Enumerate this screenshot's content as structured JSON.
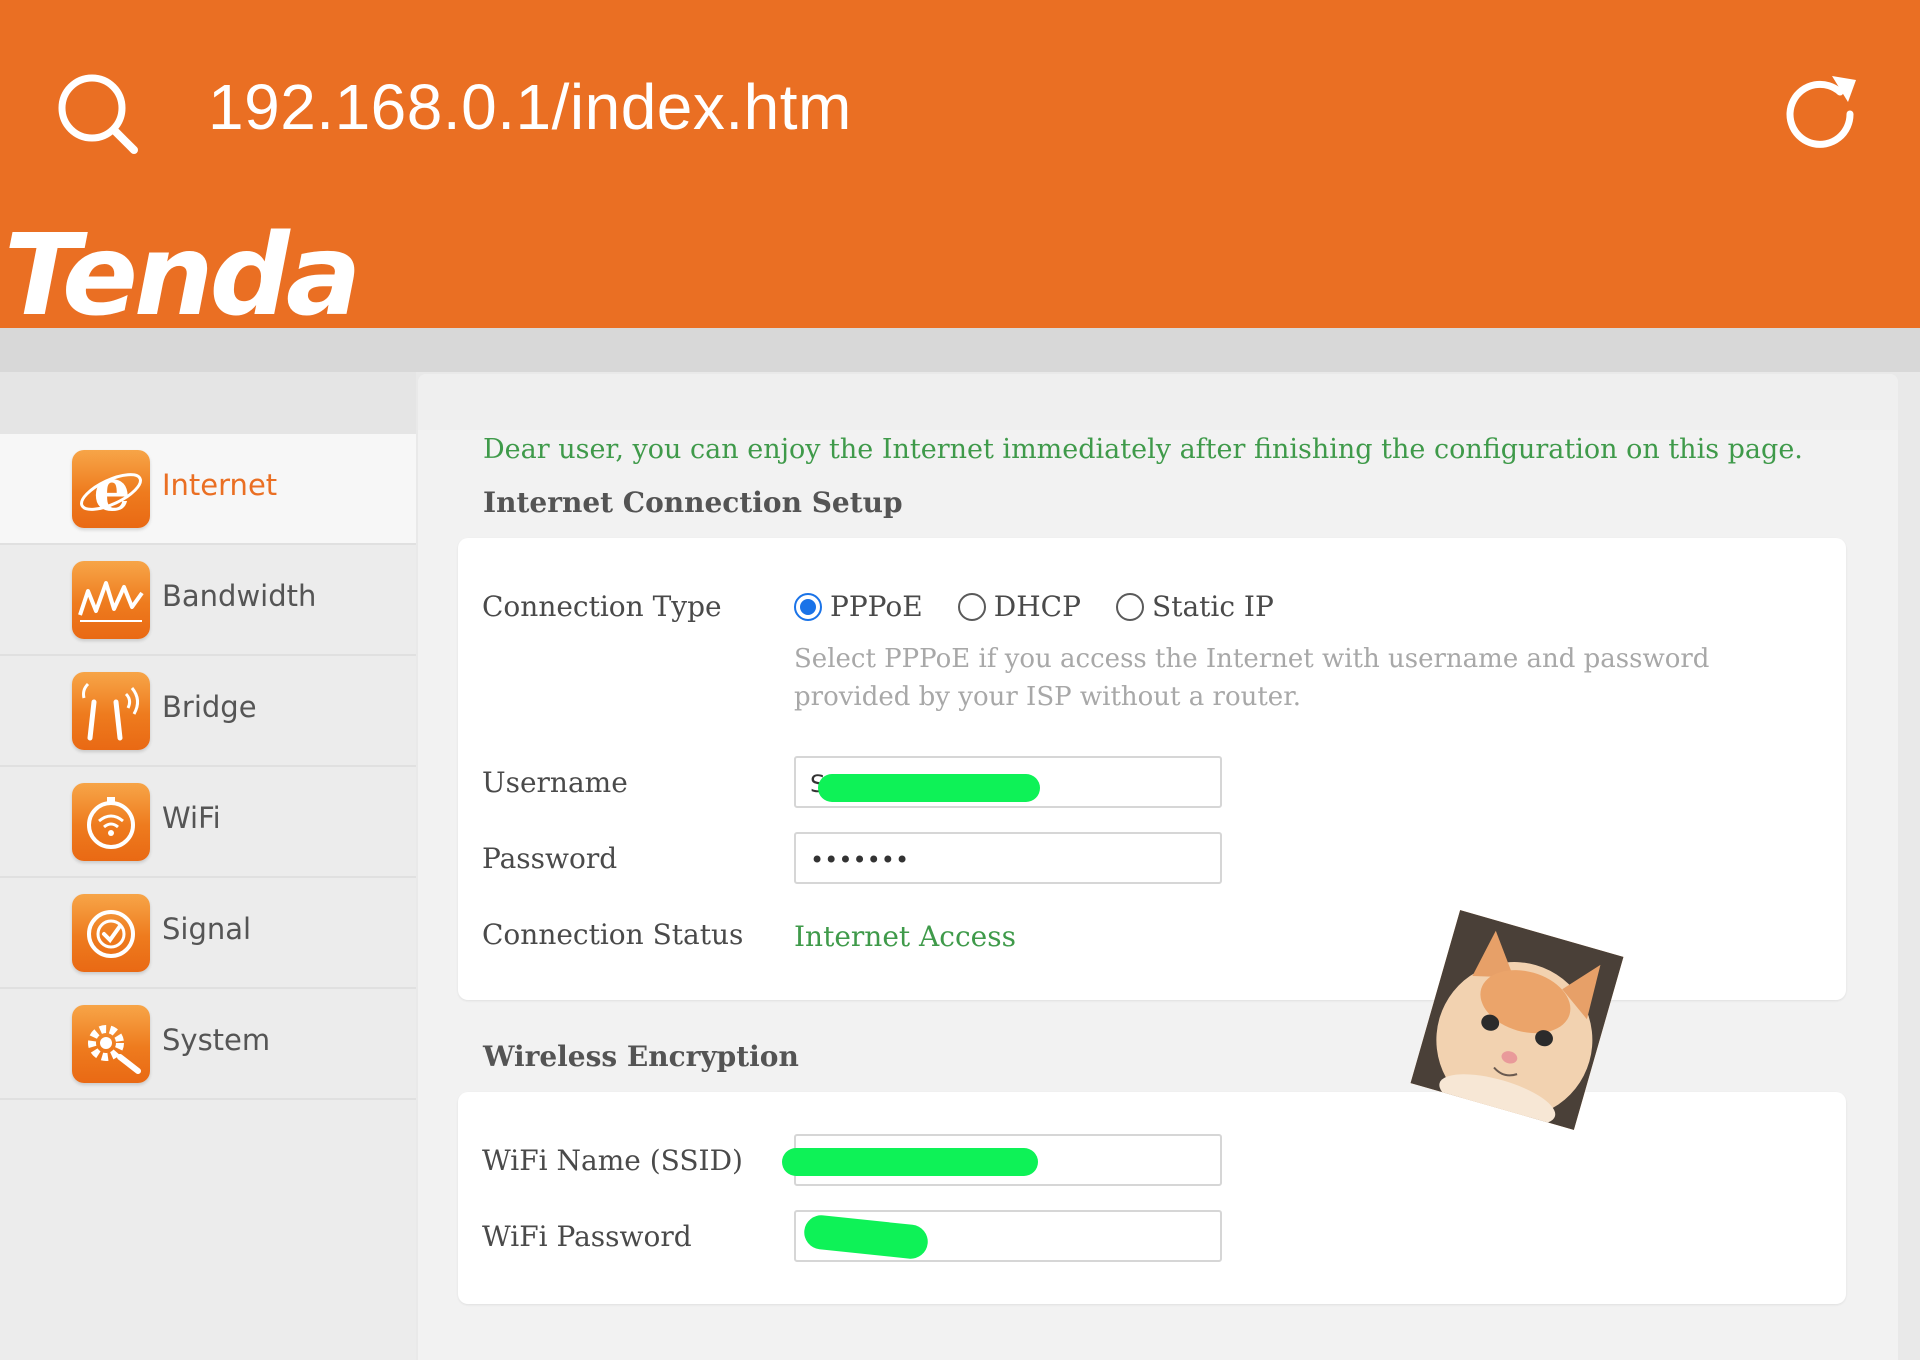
{
  "browser": {
    "url": "192.168.0.1/index.htm"
  },
  "header": {
    "logo_text": "Tenda",
    "brand_color": "#ea6f23"
  },
  "sidebar": {
    "items": [
      {
        "label": "Internet",
        "icon": "internet-explorer-icon",
        "active": true
      },
      {
        "label": "Bandwidth",
        "icon": "bandwidth-wave-icon",
        "active": false
      },
      {
        "label": "Bridge",
        "icon": "bridge-antenna-icon",
        "active": false
      },
      {
        "label": "WiFi",
        "icon": "wifi-icon",
        "active": false
      },
      {
        "label": "Signal",
        "icon": "signal-icon",
        "active": false
      },
      {
        "label": "System",
        "icon": "system-gear-icon",
        "active": false
      }
    ]
  },
  "main": {
    "intro": "Dear user, you can enjoy the Internet immediately after finishing the configuration on this page.",
    "internet_section": {
      "title": "Internet Connection Setup",
      "connection_type_label": "Connection Type",
      "options": [
        "PPPoE",
        "DHCP",
        "Static IP"
      ],
      "selected_option": "PPPoE",
      "hint": "Select PPPoE if you access the Internet with username and password provided by your ISP without a router.",
      "username_label": "Username",
      "username_value": "S",
      "password_label": "Password",
      "password_value": "•••••••",
      "status_label": "Connection Status",
      "status_value": "Internet Access"
    },
    "wireless_section": {
      "title": "Wireless Encryption",
      "ssid_label": "WiFi Name (SSID)",
      "ssid_value": "",
      "password_label": "WiFi Password",
      "password_value": ""
    }
  },
  "colors": {
    "accent": "#ea6f23",
    "status_green": "#3f9a4a",
    "redaction": "#0ef257",
    "radio_selected": "#1a73e8"
  }
}
